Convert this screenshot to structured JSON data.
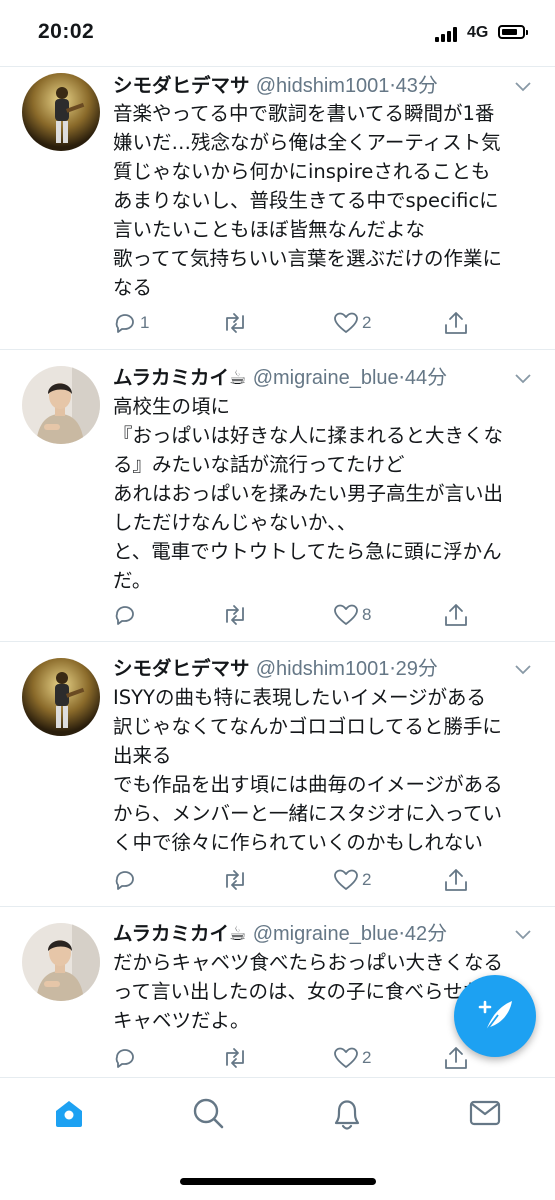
{
  "status_bar": {
    "time": "20:02",
    "network": "4G",
    "signal_icon": "cellular-signal-icon",
    "battery_icon": "battery-icon"
  },
  "colors": {
    "accent": "#1da1f2",
    "text": "#14171a",
    "secondary": "#657786",
    "divider": "#e6ecf0"
  },
  "tweets": [
    {
      "display_name": "シモダヒデマサ",
      "emoji": "",
      "handle": "@hidshim1001",
      "separator": "·",
      "time": "43分",
      "text_lines": [
        "音楽やってる中で歌詞を書いてる瞬間が1番",
        "嫌いだ…残念ながら俺は全くアーティスト気",
        "質じゃないから何かにinspireされることも",
        "あまりないし、普段生きてる中でspecificに",
        "言いたいこともほぼ皆無なんだよな",
        "歌ってて気持ちいい言葉を選ぶだけの作業に",
        "なる"
      ],
      "replies": "1",
      "retweets": "",
      "likes": "2"
    },
    {
      "display_name": "ムラカミカイ",
      "emoji": "☕",
      "handle": "@migraine_blue",
      "separator": "·",
      "time": "44分",
      "text_lines": [
        "高校生の頃に",
        "『おっぱいは好きな人に揉まれると大きくな",
        "る』みたいな話が流行ってたけど",
        "あれはおっぱいを揉みたい男子高生が言い出",
        "しただけなんじゃないか、、",
        "と、電車でウトウトしてたら急に頭に浮かん",
        "だ。"
      ],
      "replies": "",
      "retweets": "",
      "likes": "8"
    },
    {
      "display_name": "シモダヒデマサ",
      "emoji": "",
      "handle": "@hidshim1001",
      "separator": "·",
      "time": "29分",
      "text_lines": [
        "ISYYの曲も特に表現したいイメージがある",
        "訳じゃなくてなんかゴロゴロしてると勝手に",
        "出来る",
        "でも作品を出す頃には曲毎のイメージがある",
        "から、メンバーと一緒にスタジオに入ってい",
        "く中で徐々に作られていくのかもしれない"
      ],
      "replies": "",
      "retweets": "",
      "likes": "2"
    },
    {
      "display_name": "ムラカミカイ",
      "emoji": "☕",
      "handle": "@migraine_blue",
      "separator": "·",
      "time": "42分",
      "text_lines": [
        "だからキャベツ食べたらおっぱい大きくなる",
        "って言い出したのは、女の子に食べらせたい",
        "キャベツだよ。"
      ],
      "replies": "",
      "retweets": "",
      "likes": "2"
    }
  ],
  "tab_bar": {
    "items": [
      {
        "name": "home",
        "icon": "home-icon",
        "active": true
      },
      {
        "name": "search",
        "icon": "search-icon",
        "active": false
      },
      {
        "name": "notifications",
        "icon": "bell-icon",
        "active": false
      },
      {
        "name": "messages",
        "icon": "mail-icon",
        "active": false
      }
    ]
  },
  "compose_button": {
    "icon": "compose-feather-icon"
  }
}
